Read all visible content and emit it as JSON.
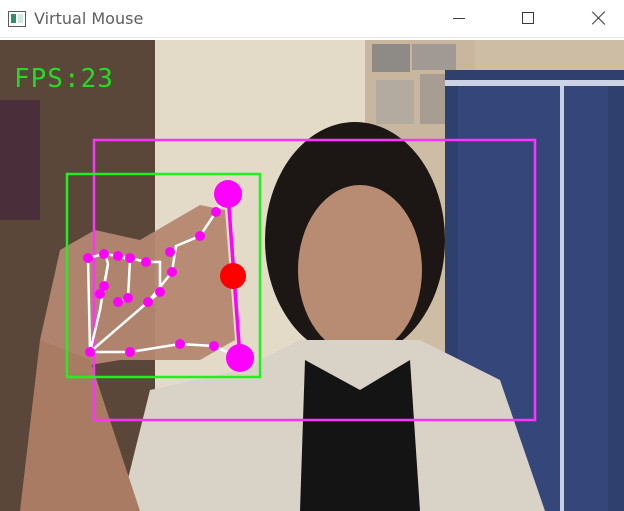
{
  "window": {
    "title": "Virtual Mouse",
    "controls": [
      "minimize",
      "maximize",
      "close"
    ]
  },
  "overlay": {
    "fps_text": "FPS:23",
    "colors": {
      "fps": "#22dd22",
      "active_region_box": "#ff33ff",
      "hand_bbox": "#22ee22",
      "landmark": "#ff00ff",
      "skeleton": "#ffffff",
      "cursor_point": "#ff0000"
    }
  }
}
